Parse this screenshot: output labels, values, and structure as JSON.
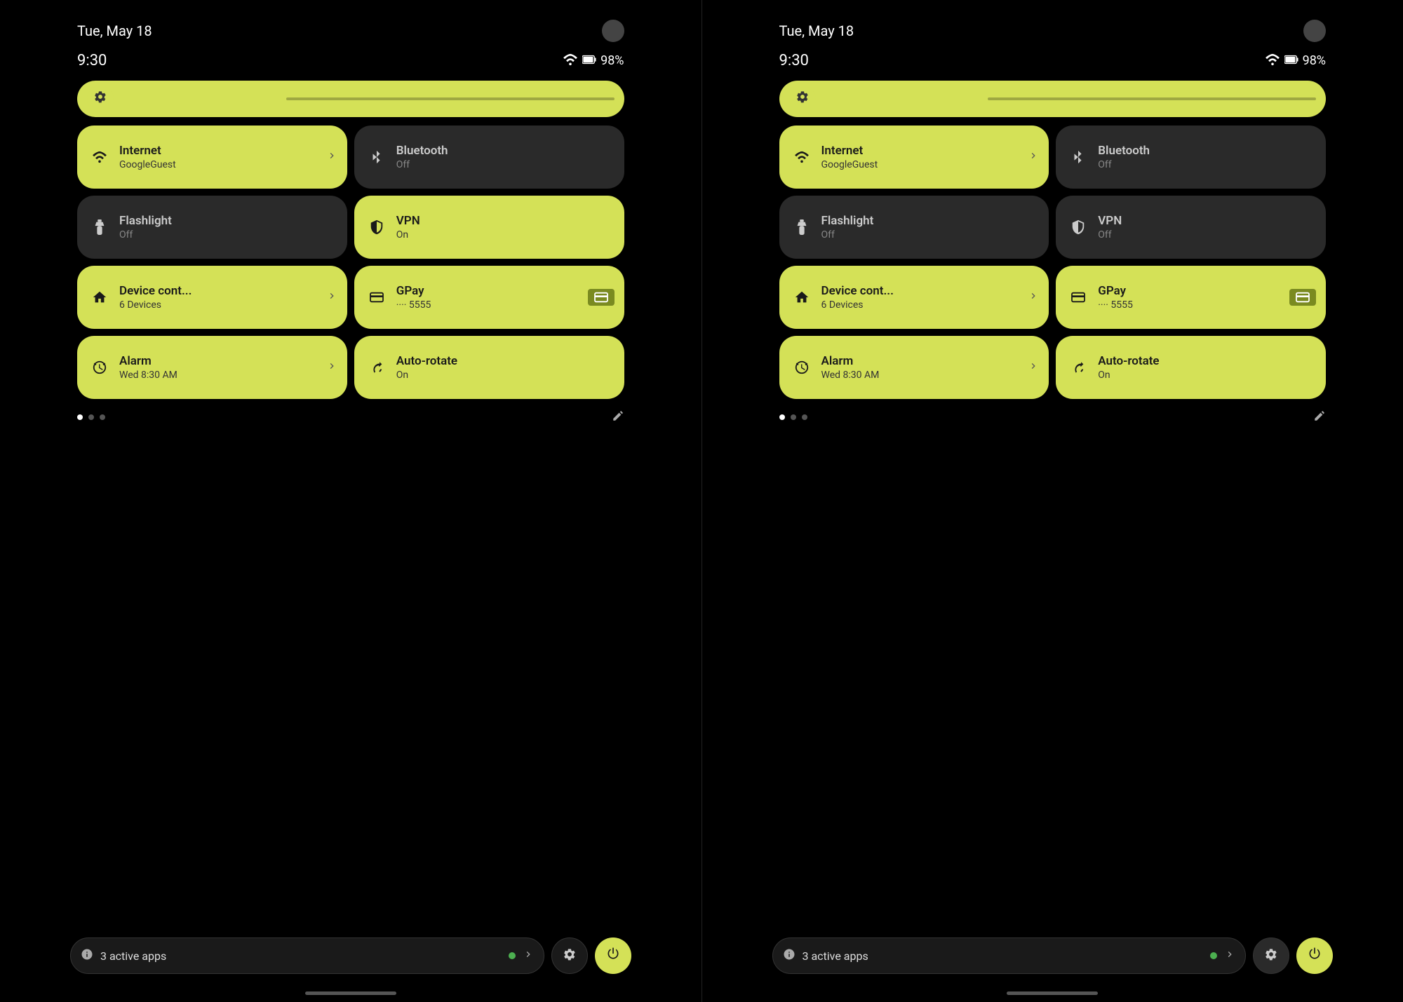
{
  "screens": [
    {
      "id": "screen-left",
      "date": "Tue, May 18",
      "time": "9:30",
      "battery": "98%",
      "brightness": 45,
      "tiles": [
        {
          "id": "internet",
          "icon": "wifi",
          "title": "Internet",
          "subtitle": "GoogleGuest",
          "active": true,
          "hasChevron": true
        },
        {
          "id": "bluetooth",
          "icon": "bluetooth",
          "title": "Bluetooth",
          "subtitle": "Off",
          "active": false,
          "hasChevron": false
        },
        {
          "id": "flashlight",
          "icon": "flashlight",
          "title": "Flashlight",
          "subtitle": "Off",
          "active": false,
          "hasChevron": false
        },
        {
          "id": "vpn",
          "icon": "vpn",
          "title": "VPN",
          "subtitle": "On",
          "active": true,
          "hasChevron": false
        },
        {
          "id": "device-control",
          "icon": "home",
          "title": "Device cont...",
          "subtitle": "6 Devices",
          "active": true,
          "hasChevron": true
        },
        {
          "id": "gpay",
          "icon": "payment",
          "title": "GPay",
          "subtitle": "···· 5555",
          "active": true,
          "hasChevron": false,
          "hasCard": true
        },
        {
          "id": "alarm",
          "icon": "alarm",
          "title": "Alarm",
          "subtitle": "Wed 8:30 AM",
          "active": true,
          "hasChevron": true
        },
        {
          "id": "autorotate",
          "icon": "autorotate",
          "title": "Auto-rotate",
          "subtitle": "On",
          "active": true,
          "hasChevron": false
        }
      ],
      "activeApps": "3 active apps",
      "dots": [
        true,
        false,
        false
      ]
    },
    {
      "id": "screen-right",
      "date": "Tue, May 18",
      "time": "9:30",
      "battery": "98%",
      "brightness": 45,
      "tiles": [
        {
          "id": "internet",
          "icon": "wifi",
          "title": "Internet",
          "subtitle": "GoogleGuest",
          "active": true,
          "hasChevron": true
        },
        {
          "id": "bluetooth",
          "icon": "bluetooth",
          "title": "Bluetooth",
          "subtitle": "Off",
          "active": false,
          "hasChevron": false
        },
        {
          "id": "flashlight",
          "icon": "flashlight",
          "title": "Flashlight",
          "subtitle": "Off",
          "active": false,
          "hasChevron": false
        },
        {
          "id": "vpn",
          "icon": "vpn",
          "title": "VPN",
          "subtitle": "Off",
          "active": false,
          "hasChevron": false
        },
        {
          "id": "device-control",
          "icon": "home",
          "title": "Device cont...",
          "subtitle": "6 Devices",
          "active": true,
          "hasChevron": true
        },
        {
          "id": "gpay",
          "icon": "payment",
          "title": "GPay",
          "subtitle": "···· 5555",
          "active": true,
          "hasChevron": false,
          "hasCard": true
        },
        {
          "id": "alarm",
          "icon": "alarm",
          "title": "Alarm",
          "subtitle": "Wed 8:30 AM",
          "active": true,
          "hasChevron": true
        },
        {
          "id": "autorotate",
          "icon": "autorotate",
          "title": "Auto-rotate",
          "subtitle": "On",
          "active": true,
          "hasChevron": false
        }
      ],
      "activeApps": "3 active apps",
      "dots": [
        true,
        false,
        false
      ]
    }
  ],
  "icons": {
    "wifi": "▼",
    "bluetooth": "✱",
    "flashlight": "🔦",
    "vpn": "🛡",
    "home": "⌂",
    "payment": "💳",
    "alarm": "⏰",
    "autorotate": "↻",
    "settings": "⚙",
    "power": "⏻",
    "edit": "✏",
    "info": "ℹ",
    "chevron_right": "›",
    "battery": "🔋"
  }
}
